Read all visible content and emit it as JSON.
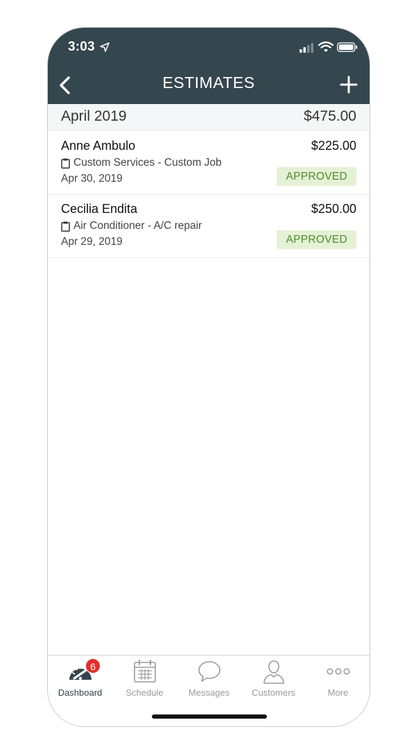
{
  "status_bar": {
    "time": "3:03"
  },
  "nav": {
    "title": "ESTIMATES",
    "back_icon": "chevron-left-icon",
    "add_icon": "plus-icon"
  },
  "section": {
    "title": "April 2019",
    "total": "$475.00"
  },
  "estimates": [
    {
      "name": "Anne Ambulo",
      "amount": "$225.00",
      "service": "Custom Services - Custom Job",
      "date": "Apr 30, 2019",
      "status": "APPROVED"
    },
    {
      "name": "Cecilia Endita",
      "amount": "$250.00",
      "service": "Air Conditioner - A/C repair",
      "date": "Apr 29, 2019",
      "status": "APPROVED"
    }
  ],
  "tabbar": {
    "badge_count": "6",
    "tabs": [
      {
        "label": "Dashboard",
        "icon": "speedometer-icon"
      },
      {
        "label": "Schedule",
        "icon": "calendar-icon"
      },
      {
        "label": "Messages",
        "icon": "chat-bubble-icon"
      },
      {
        "label": "Customers",
        "icon": "person-icon"
      },
      {
        "label": "More",
        "icon": "more-dots-icon"
      }
    ]
  },
  "colors": {
    "header": "#34464e",
    "badge_bg": "#e5f1d5",
    "badge_text": "#4c8b2b",
    "notification": "#e0302c"
  }
}
